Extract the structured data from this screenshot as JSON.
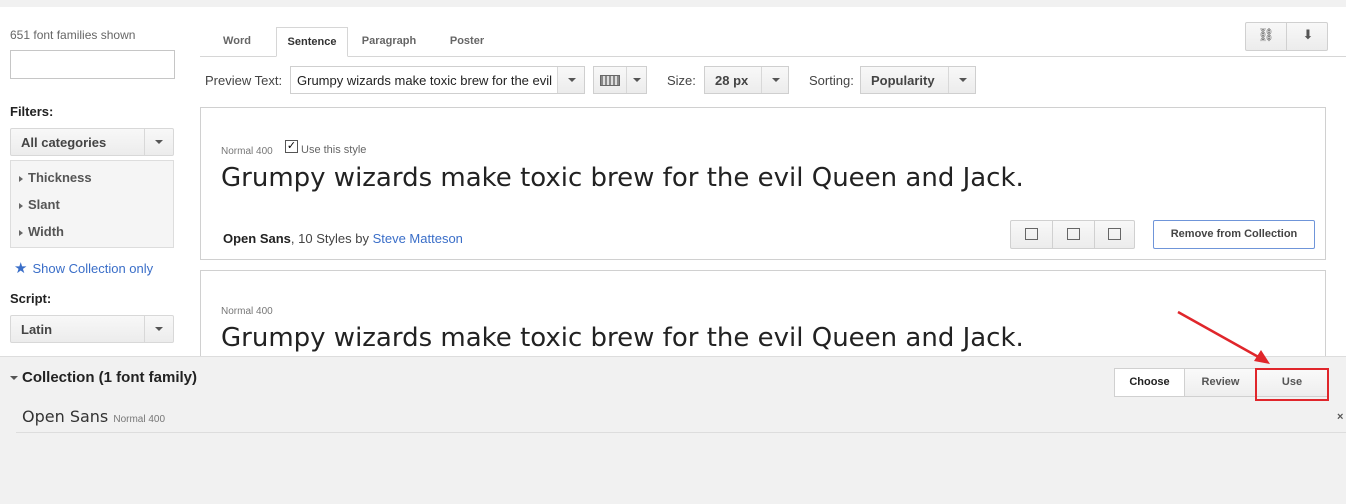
{
  "sidebar": {
    "count": "651 font families shown",
    "search_placeholder": "",
    "filters_label": "Filters:",
    "category": "All categories",
    "filter_items": [
      "Thickness",
      "Slant",
      "Width"
    ],
    "show_collection": "Show Collection only",
    "script_label": "Script:",
    "script": "Latin"
  },
  "tabs": [
    "Word",
    "Sentence",
    "Paragraph",
    "Poster"
  ],
  "active_tab": "Sentence",
  "toolbar": {
    "link_icon": "link-icon",
    "download_icon": "download-icon"
  },
  "preview": {
    "label": "Preview Text:",
    "text": "Grumpy wizards make toxic brew for the evil Queen and Jack.",
    "size_label": "Size:",
    "size": "28 px",
    "sorting_label": "Sorting:",
    "sorting": "Popularity"
  },
  "cards": [
    {
      "meta": "Normal 400",
      "use_style": "Use this style",
      "checked": true,
      "sample": "Grumpy wizards make toxic brew for the evil Queen and Jack.",
      "font": "Open Sans",
      "styles": ", 10 Styles by ",
      "author": "Steve Matteson",
      "remove": "Remove from Collection"
    },
    {
      "meta": "Normal 400",
      "sample": "Grumpy wizards make toxic brew for the evil Queen and Jack."
    }
  ],
  "collection": {
    "title": "Collection (1 font family)",
    "steps": [
      "Choose",
      "Review",
      "Use"
    ],
    "font": "Open Sans",
    "style": "Normal 400",
    "close": "×"
  },
  "colors": {
    "accent": "#3a6ec8",
    "annotation": "#e0262b"
  }
}
